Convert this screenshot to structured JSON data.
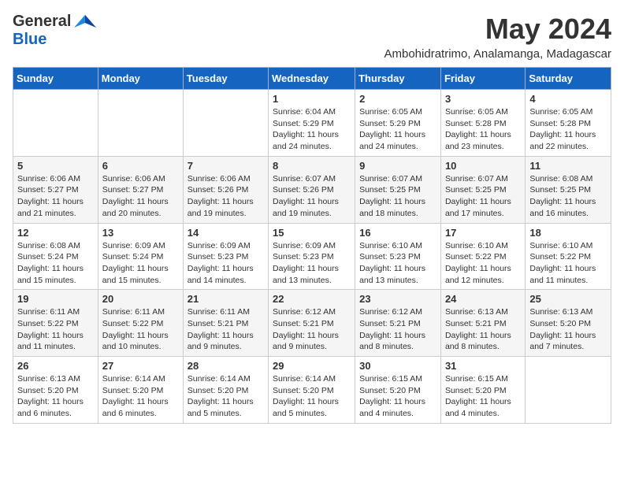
{
  "header": {
    "logo_general": "General",
    "logo_blue": "Blue",
    "month": "May 2024",
    "location": "Ambohidratrimo, Analamanga, Madagascar"
  },
  "days_of_week": [
    "Sunday",
    "Monday",
    "Tuesday",
    "Wednesday",
    "Thursday",
    "Friday",
    "Saturday"
  ],
  "weeks": [
    [
      {
        "day": "",
        "info": ""
      },
      {
        "day": "",
        "info": ""
      },
      {
        "day": "",
        "info": ""
      },
      {
        "day": "1",
        "info": "Sunrise: 6:04 AM\nSunset: 5:29 PM\nDaylight: 11 hours\nand 24 minutes."
      },
      {
        "day": "2",
        "info": "Sunrise: 6:05 AM\nSunset: 5:29 PM\nDaylight: 11 hours\nand 24 minutes."
      },
      {
        "day": "3",
        "info": "Sunrise: 6:05 AM\nSunset: 5:28 PM\nDaylight: 11 hours\nand 23 minutes."
      },
      {
        "day": "4",
        "info": "Sunrise: 6:05 AM\nSunset: 5:28 PM\nDaylight: 11 hours\nand 22 minutes."
      }
    ],
    [
      {
        "day": "5",
        "info": "Sunrise: 6:06 AM\nSunset: 5:27 PM\nDaylight: 11 hours\nand 21 minutes."
      },
      {
        "day": "6",
        "info": "Sunrise: 6:06 AM\nSunset: 5:27 PM\nDaylight: 11 hours\nand 20 minutes."
      },
      {
        "day": "7",
        "info": "Sunrise: 6:06 AM\nSunset: 5:26 PM\nDaylight: 11 hours\nand 19 minutes."
      },
      {
        "day": "8",
        "info": "Sunrise: 6:07 AM\nSunset: 5:26 PM\nDaylight: 11 hours\nand 19 minutes."
      },
      {
        "day": "9",
        "info": "Sunrise: 6:07 AM\nSunset: 5:25 PM\nDaylight: 11 hours\nand 18 minutes."
      },
      {
        "day": "10",
        "info": "Sunrise: 6:07 AM\nSunset: 5:25 PM\nDaylight: 11 hours\nand 17 minutes."
      },
      {
        "day": "11",
        "info": "Sunrise: 6:08 AM\nSunset: 5:25 PM\nDaylight: 11 hours\nand 16 minutes."
      }
    ],
    [
      {
        "day": "12",
        "info": "Sunrise: 6:08 AM\nSunset: 5:24 PM\nDaylight: 11 hours\nand 15 minutes."
      },
      {
        "day": "13",
        "info": "Sunrise: 6:09 AM\nSunset: 5:24 PM\nDaylight: 11 hours\nand 15 minutes."
      },
      {
        "day": "14",
        "info": "Sunrise: 6:09 AM\nSunset: 5:23 PM\nDaylight: 11 hours\nand 14 minutes."
      },
      {
        "day": "15",
        "info": "Sunrise: 6:09 AM\nSunset: 5:23 PM\nDaylight: 11 hours\nand 13 minutes."
      },
      {
        "day": "16",
        "info": "Sunrise: 6:10 AM\nSunset: 5:23 PM\nDaylight: 11 hours\nand 13 minutes."
      },
      {
        "day": "17",
        "info": "Sunrise: 6:10 AM\nSunset: 5:22 PM\nDaylight: 11 hours\nand 12 minutes."
      },
      {
        "day": "18",
        "info": "Sunrise: 6:10 AM\nSunset: 5:22 PM\nDaylight: 11 hours\nand 11 minutes."
      }
    ],
    [
      {
        "day": "19",
        "info": "Sunrise: 6:11 AM\nSunset: 5:22 PM\nDaylight: 11 hours\nand 11 minutes."
      },
      {
        "day": "20",
        "info": "Sunrise: 6:11 AM\nSunset: 5:22 PM\nDaylight: 11 hours\nand 10 minutes."
      },
      {
        "day": "21",
        "info": "Sunrise: 6:11 AM\nSunset: 5:21 PM\nDaylight: 11 hours\nand 9 minutes."
      },
      {
        "day": "22",
        "info": "Sunrise: 6:12 AM\nSunset: 5:21 PM\nDaylight: 11 hours\nand 9 minutes."
      },
      {
        "day": "23",
        "info": "Sunrise: 6:12 AM\nSunset: 5:21 PM\nDaylight: 11 hours\nand 8 minutes."
      },
      {
        "day": "24",
        "info": "Sunrise: 6:13 AM\nSunset: 5:21 PM\nDaylight: 11 hours\nand 8 minutes."
      },
      {
        "day": "25",
        "info": "Sunrise: 6:13 AM\nSunset: 5:20 PM\nDaylight: 11 hours\nand 7 minutes."
      }
    ],
    [
      {
        "day": "26",
        "info": "Sunrise: 6:13 AM\nSunset: 5:20 PM\nDaylight: 11 hours\nand 6 minutes."
      },
      {
        "day": "27",
        "info": "Sunrise: 6:14 AM\nSunset: 5:20 PM\nDaylight: 11 hours\nand 6 minutes."
      },
      {
        "day": "28",
        "info": "Sunrise: 6:14 AM\nSunset: 5:20 PM\nDaylight: 11 hours\nand 5 minutes."
      },
      {
        "day": "29",
        "info": "Sunrise: 6:14 AM\nSunset: 5:20 PM\nDaylight: 11 hours\nand 5 minutes."
      },
      {
        "day": "30",
        "info": "Sunrise: 6:15 AM\nSunset: 5:20 PM\nDaylight: 11 hours\nand 4 minutes."
      },
      {
        "day": "31",
        "info": "Sunrise: 6:15 AM\nSunset: 5:20 PM\nDaylight: 11 hours\nand 4 minutes."
      },
      {
        "day": "",
        "info": ""
      }
    ]
  ]
}
